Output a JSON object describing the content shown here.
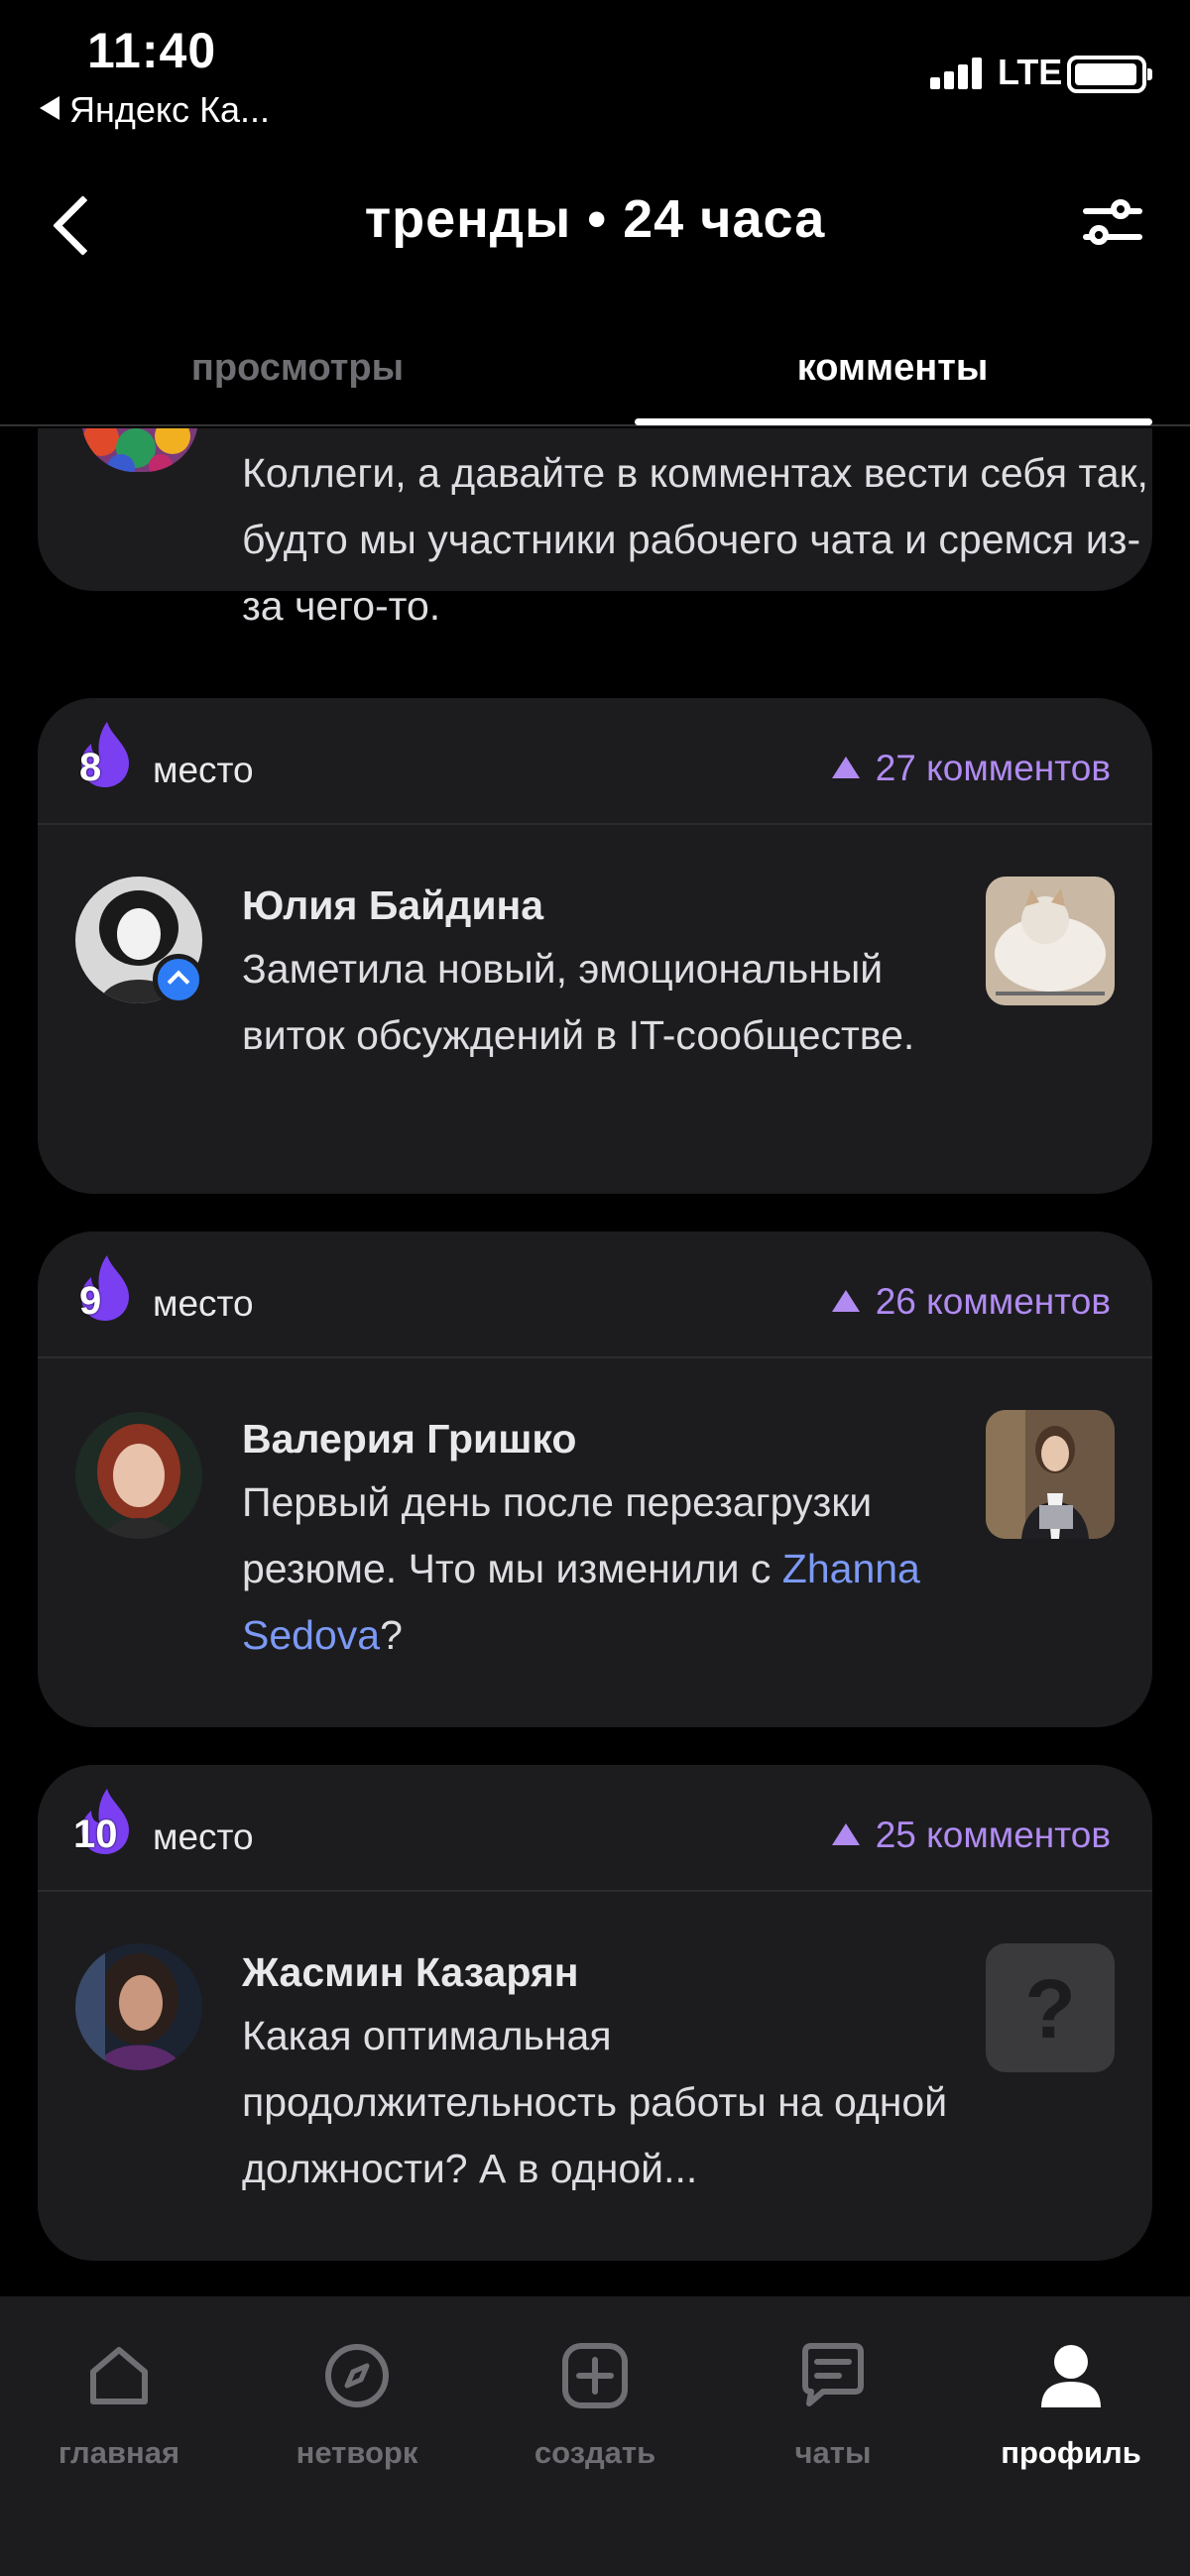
{
  "status_bar": {
    "time": "11:40",
    "back_app": "Яндекс Ка...",
    "network": "LTE"
  },
  "header": {
    "title": "тренды • 24 часа"
  },
  "tabs": [
    {
      "label": "просмотры",
      "active": false
    },
    {
      "label": "комменты",
      "active": true
    }
  ],
  "partial_post": {
    "text": "Коллеги, а давайте в комментах вести себя так, будто мы участники рабочего чата и сремся из-за чего-то."
  },
  "posts": [
    {
      "rank": "8",
      "place_label": "место",
      "comments": "27 комментов",
      "author": "Юлия Байдина",
      "text": "Заметила новый, эмоциональный виток обсуждений в IT-сообществе."
    },
    {
      "rank": "9",
      "place_label": "место",
      "comments": "26 комментов",
      "author": "Валерия Гришко",
      "text_before": "Первый день после перезагрузки резюме. Что мы изменили с ",
      "mention": "Zhanna Sedova",
      "text_after": "?"
    },
    {
      "rank": "10",
      "place_label": "место",
      "comments": "25 комментов",
      "author": "Жасмин Казарян",
      "text": "Какая оптимальная продолжительность работы на одной должности? А в одной...",
      "thumb_placeholder": "?"
    }
  ],
  "bottom_nav": [
    {
      "label": "главная",
      "icon": "home-icon",
      "active": false
    },
    {
      "label": "нетворк",
      "icon": "compass-icon",
      "active": false
    },
    {
      "label": "создать",
      "icon": "plus-square-icon",
      "active": false
    },
    {
      "label": "чаты",
      "icon": "chat-icon",
      "active": false
    },
    {
      "label": "профиль",
      "icon": "profile-icon",
      "active": true
    }
  ],
  "colors": {
    "accent_purple": "#b18bf2",
    "flame_purple": "#7b3ff2",
    "mention_blue": "#7c99f5",
    "card_bg": "#1c1c1e",
    "verified_blue": "#2d7cf6"
  }
}
